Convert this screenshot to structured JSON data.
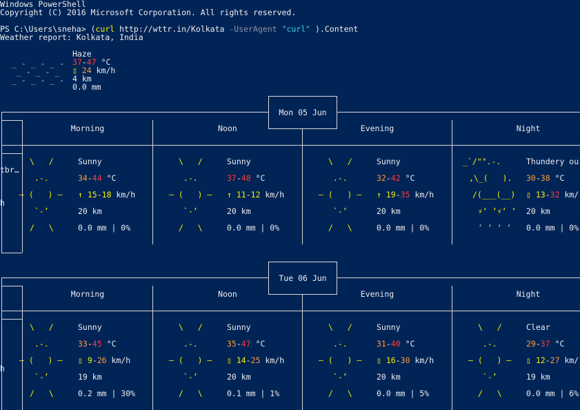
{
  "console": {
    "header_1": "Windows PowerShell",
    "header_2": "Copyright (C) 2016 Microsoft Corporation. All rights reserved.",
    "prompt": "PS C:\\Users\\sneha> ",
    "cmd_open": "(",
    "cmd_name": "curl",
    "cmd_url": " http://wttr.in/Kolkata ",
    "cmd_param": "-UserAgent",
    "cmd_space": " ",
    "cmd_value": "\"curl\"",
    "cmd_close": " ).Content",
    "report_title": "Weather report: Kolkata, India"
  },
  "current": {
    "condition": "Haze",
    "temp_low": "37",
    "temp_sep": "-",
    "temp_high": "47",
    "temp_unit": " °C",
    "wind_icon": "▯",
    "wind_speed": "24",
    "wind_unit": " km/h",
    "visibility": "4 km",
    "precip": "0.0 mm",
    "art_1": " _ - _ - _ -",
    "art_2": "  _ - _ - _",
    "art_3": " _ - _ - _ -"
  },
  "days": [
    {
      "label": "Mon 05 Jun",
      "periods": [
        {
          "name": "Morning",
          "condition": "Sunny",
          "t_low": "34",
          "t_high": "44",
          "wind_arrow": "↑",
          "w_low": "15",
          "w_high": "18",
          "visibility": "20 km",
          "precip": "0.0 mm | 0%"
        },
        {
          "name": "Noon",
          "condition": "Sunny",
          "t_low": "37",
          "t_high": "48",
          "wind_arrow": "↑",
          "w_low": "11",
          "w_high": "12",
          "visibility": "20 km",
          "precip": "0.0 mm | 0%"
        },
        {
          "name": "Evening",
          "condition": "Sunny",
          "t_low": "32",
          "t_high": "42",
          "wind_arrow": "↑",
          "w_low": "19",
          "w_high": "35",
          "visibility": "20 km",
          "precip": "0.0 mm | 0%"
        },
        {
          "name": "Night",
          "condition": "Thundery ou",
          "t_low": "30",
          "t_high": "38",
          "wind_arrow": "▯",
          "w_low": "13",
          "w_high": "32",
          "visibility": "20 km",
          "precip": "0.0 mm | 0%"
        }
      ]
    },
    {
      "label": "Tue 06 Jun",
      "periods": [
        {
          "name": "Morning",
          "condition": "Sunny",
          "t_low": "33",
          "t_high": "45",
          "wind_arrow": "▯",
          "w_low": "9",
          "w_high": "26",
          "visibility": "19 km",
          "precip": "0.2 mm | 30%"
        },
        {
          "name": "Noon",
          "condition": "Sunny",
          "t_low": "35",
          "t_high": "47",
          "wind_arrow": "▯",
          "w_low": "14",
          "w_high": "25",
          "visibility": "20 km",
          "precip": "0.1 mm | 1%"
        },
        {
          "name": "Evening",
          "condition": "Sunny",
          "t_low": "31",
          "t_high": "40",
          "wind_arrow": "▯",
          "w_low": "16",
          "w_high": "30",
          "visibility": "20 km",
          "precip": "0.0 mm | 5%"
        },
        {
          "name": "Night",
          "condition": "Clear",
          "t_low": "29",
          "t_high": "37",
          "wind_arrow": "▯",
          "w_low": "12",
          "w_high": "27",
          "visibility": "19 km",
          "precip": "0.0 mm | 6%"
        }
      ]
    }
  ],
  "fragments": {
    "left_clip_1": "tbr…",
    "left_clip_2": "h",
    "left_clip_3": "h",
    "wind_unit": " km/h",
    "wind_unit_clipped": " km/",
    "temp_unit": " °C",
    "dash": "-",
    "pipe": "|"
  },
  "art": {
    "sun_1": "\\   /",
    "sun_2": " .-.",
    "sun_3": "‒ (   ) ‒",
    "sun_4": " `-’",
    "sun_5": "/   \\",
    "thunder_1": "_`/\"\".-.",
    "thunder_2": ",\\_(   ).",
    "thunder_3": "/(___(__)",
    "thunder_4": "⚡‘ ‘⚡‘ ‘",
    "thunder_5": "‘ ‘ ‘ ‘"
  }
}
